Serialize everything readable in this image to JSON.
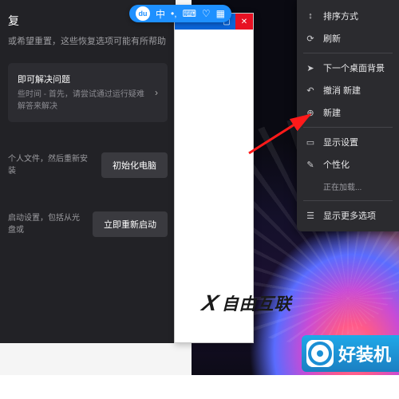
{
  "settings": {
    "title": "复",
    "subtitle": "或希望重置，这些恢复选项可能有所帮助",
    "card1": {
      "title": "即可解决问题",
      "desc": "些时间 - 首先，请尝试通过运行疑难解答来解决"
    },
    "row1": {
      "desc": "个人文件，然后重新安装",
      "btn": "初始化电脑"
    },
    "row2": {
      "desc": "启动设置，包括从光盘或",
      "btn": "立即重新启动"
    }
  },
  "ime": {
    "logo": "du",
    "mode": "中",
    "icons": [
      "punct",
      "keyboard",
      "user",
      "grid"
    ]
  },
  "blank_window": {
    "controls": [
      "min",
      "max",
      "close"
    ]
  },
  "context_menu": {
    "items": [
      {
        "icon": "sort",
        "label": "排序方式",
        "sub": false,
        "arrow": true
      },
      {
        "icon": "refresh",
        "label": "刷新",
        "sub": false
      },
      "sep",
      {
        "icon": "",
        "label": "下一个桌面背景",
        "sub": false
      },
      {
        "icon": "undo",
        "label": "撤消 新建",
        "sub": false,
        "hint": true
      },
      {
        "icon": "plus",
        "label": "新建",
        "sub": false,
        "arrow": true
      },
      "sep",
      {
        "icon": "display",
        "label": "显示设置",
        "sub": false
      },
      {
        "icon": "brush",
        "label": "个性化",
        "sub": false
      },
      {
        "icon": "",
        "label": "正在加载...",
        "sub": true
      },
      "sep",
      {
        "icon": "more",
        "label": "显示更多选项",
        "sub": false,
        "hint": true
      }
    ]
  },
  "watermarks": {
    "wm1": "自由互联",
    "wm2": "好装机"
  }
}
